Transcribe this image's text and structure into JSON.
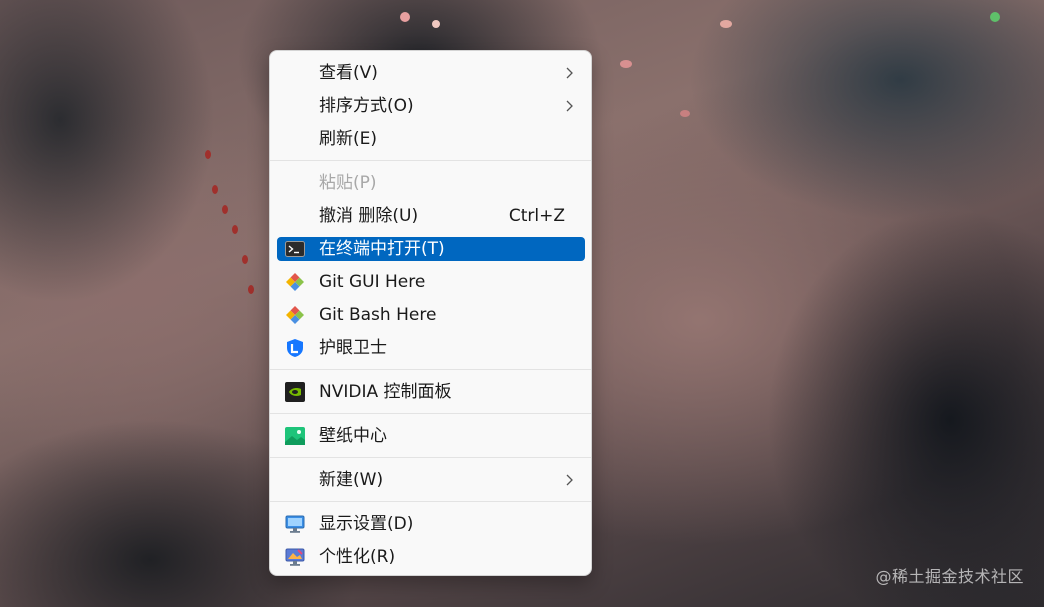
{
  "menu": {
    "items": [
      {
        "label": "查看(V)",
        "submenu": true
      },
      {
        "label": "排序方式(O)",
        "submenu": true
      },
      {
        "label": "刷新(E)"
      },
      {
        "label": "粘贴(P)",
        "disabled": true
      },
      {
        "label": "撤消 删除(U)",
        "shortcut": "Ctrl+Z"
      },
      {
        "label": "在终端中打开(T)",
        "icon": "terminal-icon",
        "highlighted": true
      },
      {
        "label": "Git GUI Here",
        "icon": "git-icon"
      },
      {
        "label": "Git Bash Here",
        "icon": "git-icon"
      },
      {
        "label": "护眼卫士",
        "icon": "eye-guard-icon"
      },
      {
        "label": "NVIDIA 控制面板",
        "icon": "nvidia-icon"
      },
      {
        "label": "壁纸中心",
        "icon": "wallpaper-icon"
      },
      {
        "label": "新建(W)",
        "submenu": true
      },
      {
        "label": "显示设置(D)",
        "icon": "display-settings-icon"
      },
      {
        "label": "个性化(R)",
        "icon": "personalize-icon"
      }
    ]
  },
  "watermark": "@稀土掘金技术社区",
  "colors": {
    "highlight": "#0067c0",
    "menu_bg": "#f9f9f9",
    "separator": "#e3e3e3",
    "disabled_text": "#a8a8a8"
  }
}
